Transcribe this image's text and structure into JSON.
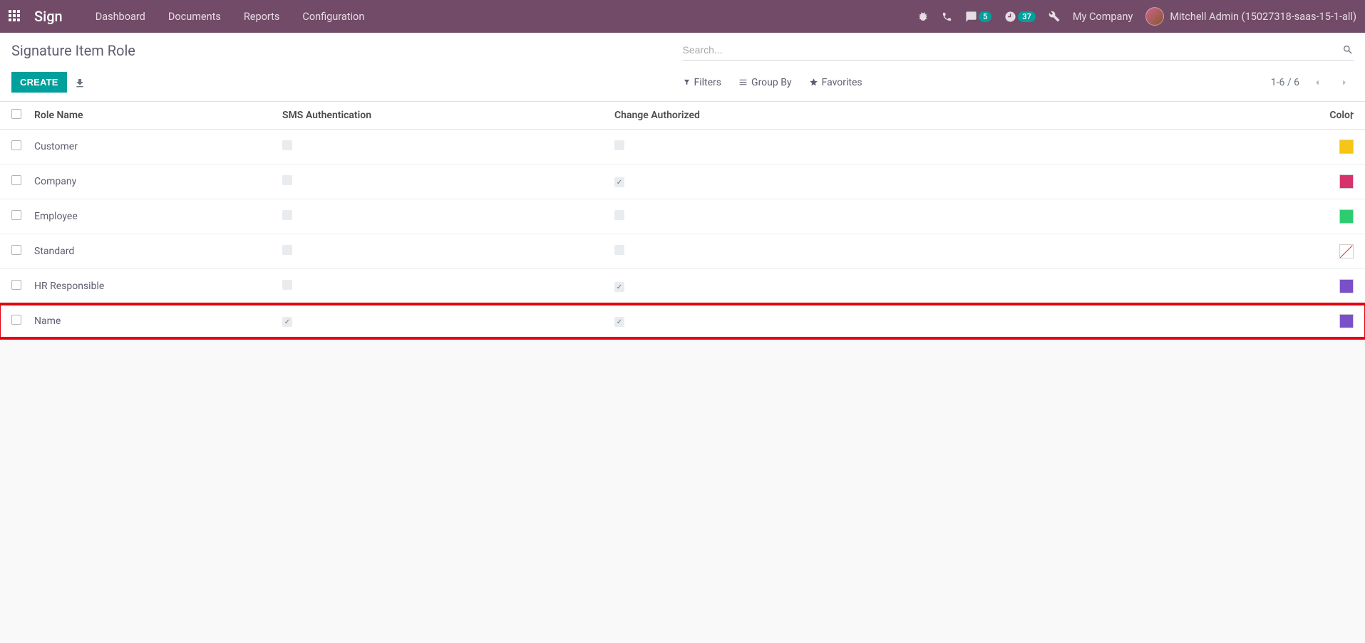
{
  "navbar": {
    "brand": "Sign",
    "menu": [
      "Dashboard",
      "Documents",
      "Reports",
      "Configuration"
    ],
    "badges": {
      "messages": "5",
      "activities": "37"
    },
    "company": "My Company",
    "user": "Mitchell Admin (15027318-saas-15-1-all)"
  },
  "control": {
    "title": "Signature Item Role",
    "create": "CREATE",
    "search_placeholder": "Search...",
    "filters": "Filters",
    "groupby": "Group By",
    "favorites": "Favorites",
    "pager": "1-6 / 6"
  },
  "table": {
    "headers": {
      "name": "Role Name",
      "sms": "SMS Authentication",
      "change": "Change Authorized",
      "color": "Color"
    },
    "rows": [
      {
        "name": "Customer",
        "sms": false,
        "change": false,
        "color": "#f5c518",
        "highlight": false
      },
      {
        "name": "Company",
        "sms": false,
        "change": true,
        "color": "#d6336c",
        "highlight": false
      },
      {
        "name": "Employee",
        "sms": false,
        "change": false,
        "color": "#2ecc71",
        "highlight": false
      },
      {
        "name": "Standard",
        "sms": false,
        "change": false,
        "color": "none",
        "highlight": false
      },
      {
        "name": "HR Responsible",
        "sms": false,
        "change": true,
        "color": "#7950c8",
        "highlight": false
      },
      {
        "name": "Name",
        "sms": true,
        "change": true,
        "color": "#7950c8",
        "highlight": true
      }
    ]
  }
}
